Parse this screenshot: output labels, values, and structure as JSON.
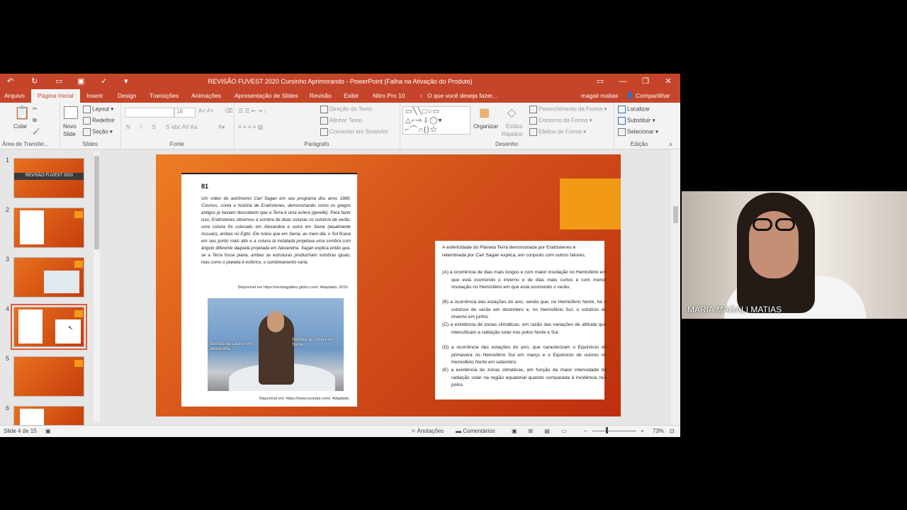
{
  "window": {
    "title": "REVISÃO FUVEST 2020 Cursinho Aprimorando - PowerPoint (Falha na Ativação do Produto)"
  },
  "tabs": [
    {
      "label": "Arquivo"
    },
    {
      "label": "Página Inicial"
    },
    {
      "label": "Inserir"
    },
    {
      "label": "Design"
    },
    {
      "label": "Transições"
    },
    {
      "label": "Animações"
    },
    {
      "label": "Apresentação de Slides"
    },
    {
      "label": "Revisão"
    },
    {
      "label": "Exibir"
    },
    {
      "label": "Nitro Pro 10"
    }
  ],
  "tell_me": "O que você deseja fazer...",
  "user": "magali matias",
  "share": "Compartilhar",
  "ribbon": {
    "clipboard": {
      "paste": "Colar",
      "group": "Área de Transfer..."
    },
    "slides": {
      "new": "Novo",
      "new2": "Slide",
      "layout": "Layout",
      "reset": "Redefinir",
      "section": "Seção",
      "group": "Slides"
    },
    "font": {
      "size": "18",
      "group": "Fonte"
    },
    "paragraph": {
      "direction": "Direção do Texto",
      "align": "Alinhar Texto",
      "smartart": "Converter em SmartArt",
      "group": "Parágrafo"
    },
    "drawing": {
      "arrange": "Organizar",
      "styles": "Estilos",
      "styles2": "Rápidos",
      "fill": "Preenchimento da Forma",
      "outline": "Contorno da Forma",
      "effects": "Efeitos de Forma",
      "group": "Desenho"
    },
    "editing": {
      "find": "Localizar",
      "replace": "Substituir",
      "select": "Selecionar",
      "group": "Edição"
    }
  },
  "thumbnails": [
    {
      "num": "1",
      "title": "REVISÃO FUVEST 2020"
    },
    {
      "num": "2"
    },
    {
      "num": "3"
    },
    {
      "num": "4"
    },
    {
      "num": "5"
    },
    {
      "num": "6"
    }
  ],
  "slide": {
    "question_number": "81",
    "question_text": "Um vídeo do astrônomo Carl Sagan em seu programa dos anos 1980, Cosmos, conta a história de Eratóstenes, demonstrando como os gregos antigos já haviam descoberto que a Terra é uma esfera (geoide). Para fazer isso, Eratóstenes observou a sombra de duas colunas no solstício de verão; uma coluna foi colocado em Alexandria e outra em Siena (atualmente Assuan), ambas no Egito. Ele notou que em Siena, ao meio dia, o Sol ficava em seu ponto mais alto e a coluna lá instalada projetava uma sombra com ângulo diferente daquela projetada em Alexandria. Sagan explica então que, se a Terra fosse plana, ambas as estruturas produziriam sombras iguais, mas como o planeta é esférico, o sombreamento varia.",
    "source1": "Disponível em https://revistagalileu.globo.com/. Adaptado. 2019.",
    "photo_caption_left": "Sombra da coluna em Alexandria",
    "photo_caption_right": "Sombra da coluna em Siena",
    "source2": "Disponível em: https://www.youtube.com/. Adaptado.",
    "answer_stem": "A esfericidade do Planeta Terra demonstrada por Eratóstenes e relembrada por Carl Sagan explica, em conjunto com outros fatores,",
    "options": [
      "(A) a ocorrência de dias mais longos e com maior insolação no Hemisfério em que está ocorrendo o inverno e de dias mais curtos e com menor insolação no Hemisfério em que está ocorrendo o verão.",
      "(B) a ocorrência das estações do ano, sendo que, no Hemisfério Norte, há o solstício de verão em dezembro e, no Hemisfério Sul, o solstício de inverno em junho.",
      "(C) a existência de zonas climáticas, em razão das variações de altitude que intensificam a radiação solar nos polos Norte e Sul.",
      "(D) a ocorrência das estações do ano, que caracterizam o Equinócio de primavera no Hemisfério Sul em março e o Equinócio de outono no Hemisfério Norte em setembro.",
      "(E) a existência de zonas climáticas, em função da maior intensidade da radiação solar na região equatorial quando comparada à incidência nos polos."
    ]
  },
  "status": {
    "slide_counter": "Slide 4 de 15",
    "notes": "Anotações",
    "comments": "Comentários",
    "zoom": "73%"
  },
  "video": {
    "participant_name": "MARIA MAGALI MATIAS"
  },
  "colors": {
    "accent": "#c5452a",
    "slide_orange": "#f29a16"
  }
}
